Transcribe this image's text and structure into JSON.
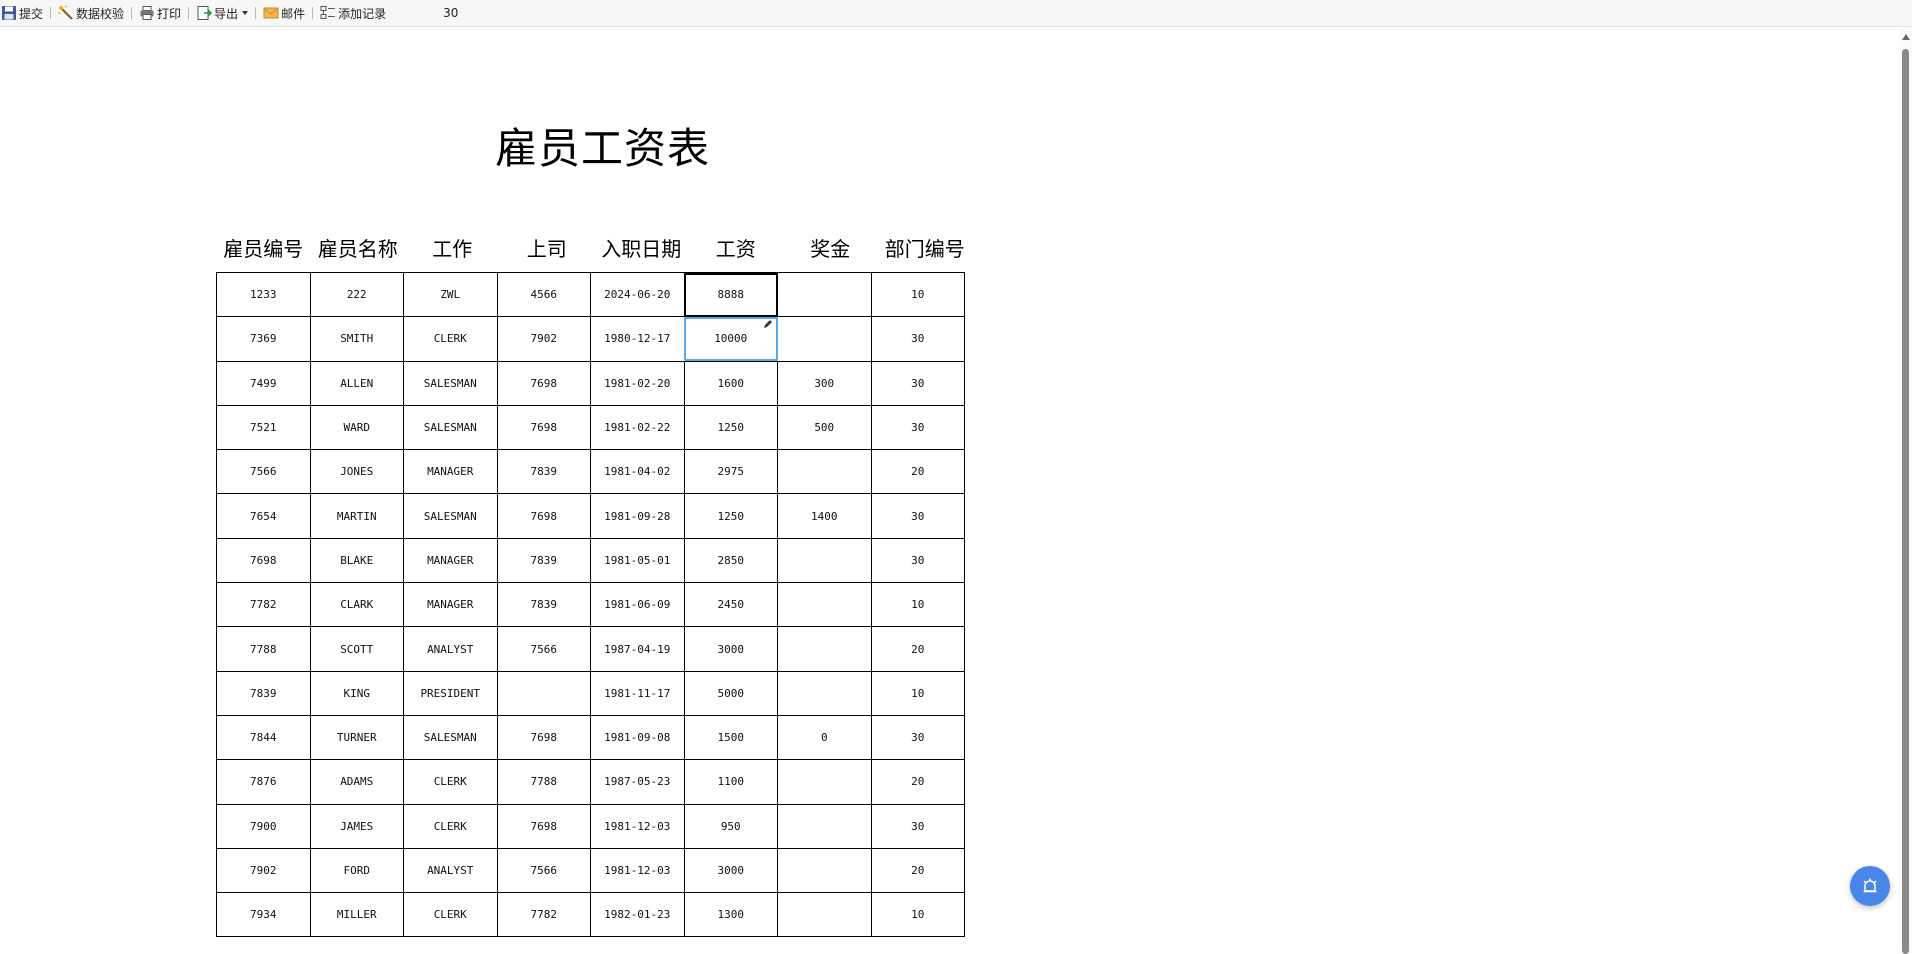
{
  "toolbar": {
    "submit_label": "提交",
    "validate_label": "数据校验",
    "print_label": "打印",
    "export_label": "导出",
    "mail_label": "邮件",
    "add_record_label": "添加记录",
    "page_value": "30"
  },
  "report": {
    "title": "雇员工资表",
    "headers": [
      "雇员编号",
      "雇员名称",
      "工作",
      "上司",
      "入职日期",
      "工资",
      "奖金",
      "部门编号"
    ],
    "rows": [
      [
        "1233",
        "222",
        "ZWL",
        "4566",
        "2024-06-20",
        "8888",
        "",
        "10"
      ],
      [
        "7369",
        "SMITH",
        "CLERK",
        "7902",
        "1980-12-17",
        "10000",
        "",
        "30"
      ],
      [
        "7499",
        "ALLEN",
        "SALESMAN",
        "7698",
        "1981-02-20",
        "1600",
        "300",
        "30"
      ],
      [
        "7521",
        "WARD",
        "SALESMAN",
        "7698",
        "1981-02-22",
        "1250",
        "500",
        "30"
      ],
      [
        "7566",
        "JONES",
        "MANAGER",
        "7839",
        "1981-04-02",
        "2975",
        "",
        "20"
      ],
      [
        "7654",
        "MARTIN",
        "SALESMAN",
        "7698",
        "1981-09-28",
        "1250",
        "1400",
        "30"
      ],
      [
        "7698",
        "BLAKE",
        "MANAGER",
        "7839",
        "1981-05-01",
        "2850",
        "",
        "30"
      ],
      [
        "7782",
        "CLARK",
        "MANAGER",
        "7839",
        "1981-06-09",
        "2450",
        "",
        "10"
      ],
      [
        "7788",
        "SCOTT",
        "ANALYST",
        "7566",
        "1987-04-19",
        "3000",
        "",
        "20"
      ],
      [
        "7839",
        "KING",
        "PRESIDENT",
        "",
        "1981-11-17",
        "5000",
        "",
        "10"
      ],
      [
        "7844",
        "TURNER",
        "SALESMAN",
        "7698",
        "1981-09-08",
        "1500",
        "0",
        "30"
      ],
      [
        "7876",
        "ADAMS",
        "CLERK",
        "7788",
        "1987-05-23",
        "1100",
        "",
        "20"
      ],
      [
        "7900",
        "JAMES",
        "CLERK",
        "7698",
        "1981-12-03",
        "950",
        "",
        "30"
      ],
      [
        "7902",
        "FORD",
        "ANALYST",
        "7566",
        "1981-12-03",
        "3000",
        "",
        "20"
      ],
      [
        "7934",
        "MILLER",
        "CLERK",
        "7782",
        "1982-01-23",
        "1300",
        "",
        "10"
      ]
    ]
  },
  "icons": {
    "submit": "save-icon",
    "validate": "magic-wand-icon",
    "print": "printer-icon",
    "export": "export-icon",
    "mail": "mail-icon",
    "add_record": "add-record-icon",
    "edit": "pencil-icon",
    "fab": "alarm-icon"
  },
  "colors": {
    "accent": "#4a86e8",
    "editing_border": "#5aa7e8"
  }
}
